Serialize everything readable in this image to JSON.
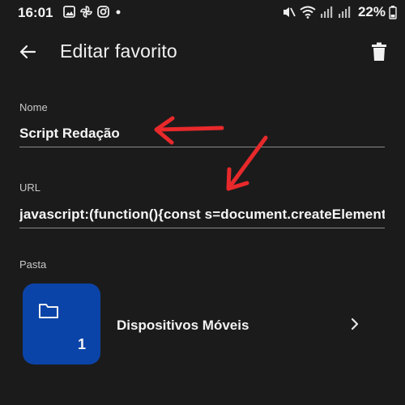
{
  "status_bar": {
    "time": "16:01",
    "battery": "22%",
    "left_icons": [
      "image-icon",
      "pinwheel-icon",
      "instagram-icon",
      "dot-icon"
    ],
    "right_icons": [
      "mute-icon",
      "wifi-icon",
      "signal-icon",
      "signal-icon",
      "battery-icon"
    ]
  },
  "app_bar": {
    "title": "Editar favorito",
    "back_icon": "arrow-back-icon",
    "delete_icon": "trash-icon"
  },
  "form": {
    "name_label": "Nome",
    "name_value": "Script Redação",
    "url_label": "URL",
    "url_value": "javascript:(function(){const s=document.createElement('sc"
  },
  "folder": {
    "label": "Pasta",
    "name": "Dispositivos Móveis",
    "count": "1",
    "icon": "folder-icon",
    "chevron": "chevron-right-icon",
    "tile_color": "#0b44a8"
  },
  "annotations": {
    "arrow_color": "#e8292b",
    "arrows": [
      "arrow-to-name",
      "arrow-to-url"
    ]
  },
  "colors": {
    "background": "#1c1b1c",
    "text": "#f2f2f2",
    "muted": "#c8c8c8"
  }
}
